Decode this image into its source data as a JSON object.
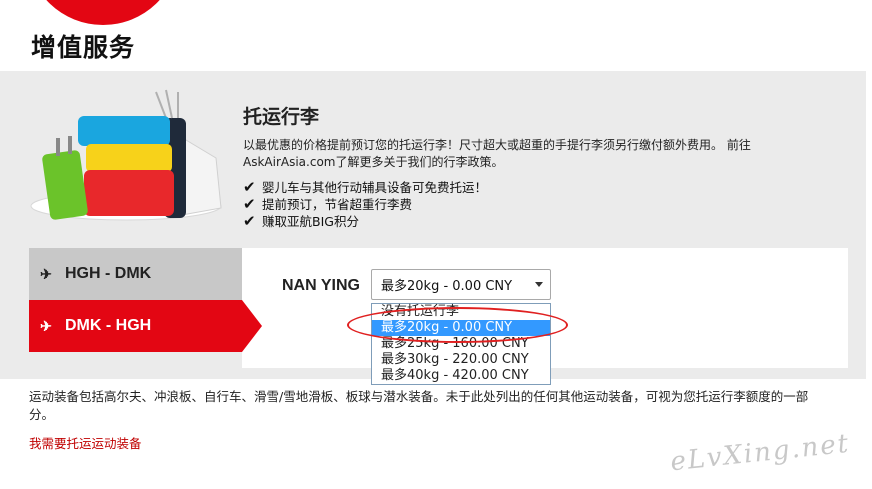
{
  "section": {
    "title": "增值服务"
  },
  "baggage": {
    "title": "托运行李",
    "description": "以最优惠的价格提前预订您的托运行李！尺寸超大或超重的手提行李须另行缴付额外费用。 前往AskAirAsia.com了解更多关于我们的行李政策。",
    "features": [
      "婴儿车与其他行动辅具设备可免费托运！",
      "提前预订，节省超重行李费",
      "赚取亚航BIG积分"
    ]
  },
  "flights": [
    {
      "label": "HGH - DMK",
      "icon": "plane-takeoff-icon"
    },
    {
      "label": "DMK - HGH",
      "icon": "plane-takeoff-icon"
    }
  ],
  "passenger": {
    "name": "NAN YING"
  },
  "baggage_select": {
    "value": "最多20kg - 0.00 CNY",
    "options": [
      "没有托运行李",
      "最多20kg - 0.00 CNY",
      "最多25kg - 160.00 CNY",
      "最多30kg - 220.00 CNY",
      "最多40kg - 420.00 CNY"
    ],
    "highlighted_index": 1
  },
  "sports": {
    "text": "运动装备包括高尔夫、冲浪板、自行车、滑雪/雪地滑板、板球与潜水装备。未于此处列出的任何其他运动装备，可视为您托运行李额度的一部分。",
    "link": "我需要托运运动装备"
  },
  "watermark": "eLvXing.net",
  "colors": {
    "brand_red": "#e30613",
    "selected_option": "#3399ff",
    "link_red": "#c00000"
  }
}
